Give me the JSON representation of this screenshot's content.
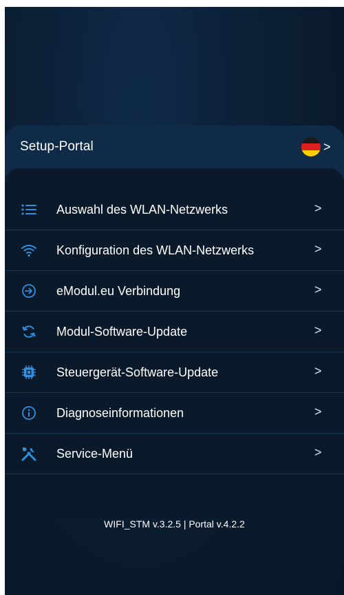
{
  "portal": {
    "title": "Setup-Portal",
    "language_chevron": ">"
  },
  "menu": [
    {
      "id": "wifi-list",
      "label": "Auswahl des WLAN-Netzwerks",
      "icon": "list-icon",
      "chevron": ">"
    },
    {
      "id": "wifi-config",
      "label": "Konfiguration des WLAN-Netzwerks",
      "icon": "wifi-icon",
      "chevron": ">"
    },
    {
      "id": "emodul",
      "label": "eModul.eu Verbindung",
      "icon": "arrow-circle-icon",
      "chevron": ">"
    },
    {
      "id": "module-update",
      "label": "Modul-Software-Update",
      "icon": "refresh-icon",
      "chevron": ">"
    },
    {
      "id": "controller-update",
      "label": "Steuergerät-Software-Update",
      "icon": "chip-icon",
      "chevron": ">"
    },
    {
      "id": "diagnostics",
      "label": "Diagnoseinformationen",
      "icon": "info-icon",
      "chevron": ">"
    },
    {
      "id": "service",
      "label": "Service-Menü",
      "icon": "tools-icon",
      "chevron": ">"
    }
  ],
  "footer": {
    "version": "WIFI_STM v.3.2.5 | Portal v.4.2.2"
  },
  "colors": {
    "background": "#0a1a2c",
    "card": "#0f2b47",
    "panel": "#0b1a2b",
    "icon_accent": "#2f8fe0",
    "divider": "#1b3756"
  }
}
